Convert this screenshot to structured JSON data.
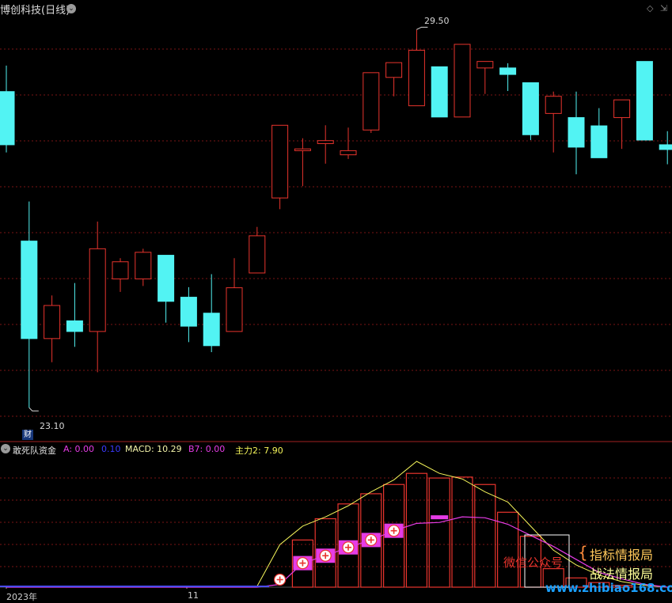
{
  "window": {
    "title": "博创科技(日线)",
    "title_visible": "博创科技(日线)"
  },
  "price_chart": {
    "high_marker": "29.50",
    "low_marker": "23.10",
    "fin_badge": "财"
  },
  "indicator": {
    "name": "敢死队资金",
    "a_label": "A: 0.00",
    "a2_label": "0.10",
    "macd_label": "MACD: 10.29",
    "b7_label": "B7: 0.00",
    "main_label": "主力2: 7.90"
  },
  "x_axis": {
    "labels": [
      "2023年",
      "11"
    ]
  },
  "watermark": {
    "left": "微信公众号",
    "right_top": "指标情报局",
    "right_bottom": "战法情报局",
    "url": "www.zhibiao168.com"
  },
  "colors": {
    "up": "#e8342d",
    "down": "#52f3f3",
    "yellow": "#f5f55a",
    "magenta": "#e63ce6",
    "grid": "#7a1515",
    "blue": "#4c4cff"
  },
  "chart_data": [
    {
      "type": "candlestick",
      "title": "博创科技(日线)",
      "annotations": [
        "29.50",
        "23.10"
      ],
      "candles": [
        {
          "o": 28.45,
          "h": 28.89,
          "l": 27.42,
          "c": 27.55
        },
        {
          "o": 25.92,
          "h": 26.59,
          "l": 23.1,
          "c": 24.27
        },
        {
          "o": 24.27,
          "h": 25.0,
          "l": 23.87,
          "c": 24.83
        },
        {
          "o": 24.57,
          "h": 25.21,
          "l": 24.13,
          "c": 24.39
        },
        {
          "o": 24.39,
          "h": 26.25,
          "l": 23.7,
          "c": 25.79
        },
        {
          "o": 25.28,
          "h": 25.63,
          "l": 25.06,
          "c": 25.57
        },
        {
          "o": 25.28,
          "h": 25.79,
          "l": 25.16,
          "c": 25.73
        },
        {
          "o": 25.68,
          "h": 25.68,
          "l": 24.54,
          "c": 24.9
        },
        {
          "o": 24.97,
          "h": 25.14,
          "l": 24.21,
          "c": 24.48
        },
        {
          "o": 24.7,
          "h": 25.36,
          "l": 24.04,
          "c": 24.15
        },
        {
          "o": 24.39,
          "h": 25.63,
          "l": 24.39,
          "c": 25.13
        },
        {
          "o": 25.38,
          "h": 26.16,
          "l": 25.38,
          "c": 26.01
        },
        {
          "o": 26.65,
          "h": 27.82,
          "l": 26.46,
          "c": 27.88
        },
        {
          "o": 27.45,
          "h": 27.66,
          "l": 26.85,
          "c": 27.48
        },
        {
          "o": 27.57,
          "h": 27.88,
          "l": 27.23,
          "c": 27.62
        },
        {
          "o": 27.38,
          "h": 27.84,
          "l": 27.31,
          "c": 27.45
        },
        {
          "o": 27.8,
          "h": 28.62,
          "l": 27.75,
          "c": 28.77
        },
        {
          "o": 28.69,
          "h": 28.94,
          "l": 28.37,
          "c": 28.94
        },
        {
          "o": 28.21,
          "h": 29.5,
          "l": 28.66,
          "c": 29.15
        },
        {
          "o": 28.87,
          "h": 28.62,
          "l": 28.62,
          "c": 28.02
        },
        {
          "o": 28.02,
          "h": 29.01,
          "l": 28.33,
          "c": 29.25
        },
        {
          "o": 28.85,
          "h": 28.93,
          "l": 28.41,
          "c": 28.96
        },
        {
          "o": 28.85,
          "h": 28.93,
          "l": 28.46,
          "c": 28.74
        },
        {
          "o": 28.6,
          "h": 28.6,
          "l": 27.63,
          "c": 27.72
        },
        {
          "o": 28.08,
          "h": 28.45,
          "l": 27.42,
          "c": 28.37
        },
        {
          "o": 28.01,
          "h": 28.45,
          "l": 27.05,
          "c": 27.51
        },
        {
          "o": 27.87,
          "h": 28.17,
          "l": 27.56,
          "c": 27.33
        },
        {
          "o": 28.01,
          "h": 28.27,
          "l": 27.48,
          "c": 28.31
        },
        {
          "o": 28.96,
          "h": 28.96,
          "l": 27.79,
          "c": 27.63
        },
        {
          "o": 27.55,
          "h": 27.78,
          "l": 27.22,
          "c": 27.47
        }
      ]
    },
    {
      "type": "bar",
      "title": "敢死队资金",
      "series": [
        {
          "name": "MACD",
          "values": [
            0,
            0,
            0,
            0,
            0,
            0,
            0,
            0,
            0,
            0,
            0,
            0,
            0,
            5.1,
            7.4,
            9.0,
            10.1,
            11.1,
            12.3,
            11.8,
            11.9,
            11.1,
            8.1,
            5.5,
            2.0,
            1.0,
            0.5,
            0.2,
            0,
            0
          ]
        },
        {
          "name": "B7",
          "values": [
            0,
            0,
            0,
            0,
            0,
            0,
            0,
            0,
            0,
            0,
            0,
            0,
            0.3,
            2.6,
            3.4,
            4.3,
            5.1,
            6.1,
            6.9,
            7.0,
            7.6,
            7.5,
            6.8,
            5.6,
            4.4,
            3.0,
            1.6,
            0.9,
            0.3,
            0
          ]
        },
        {
          "name": "主力2",
          "values": [
            0,
            0,
            0,
            0,
            0,
            0,
            0,
            0,
            0,
            0,
            0,
            0.1,
            4.6,
            6.6,
            7.6,
            8.8,
            10.3,
            11.6,
            13.6,
            12.3,
            11.7,
            10.3,
            9.2,
            6.6,
            4.0,
            2.4,
            1.3,
            0.6,
            0.2,
            0
          ]
        }
      ]
    }
  ]
}
